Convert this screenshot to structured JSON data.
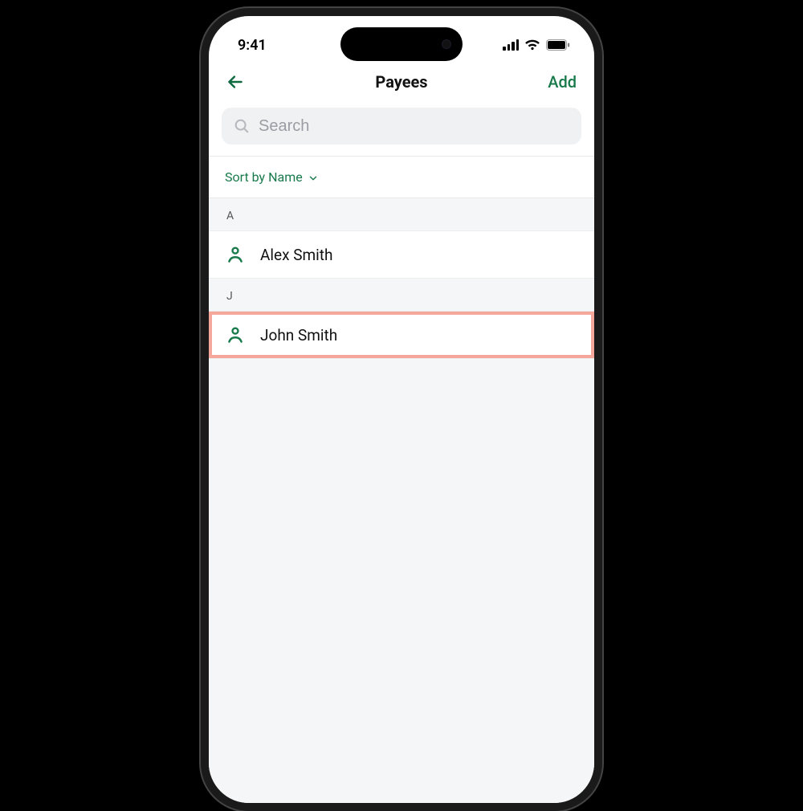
{
  "status": {
    "time": "9:41"
  },
  "nav": {
    "title": "Payees",
    "add_label": "Add"
  },
  "search": {
    "placeholder": "Search"
  },
  "sort": {
    "label": "Sort by Name"
  },
  "sections": [
    {
      "letter": "A",
      "items": [
        {
          "name": "Alex Smith",
          "highlighted": false
        }
      ]
    },
    {
      "letter": "J",
      "items": [
        {
          "name": "John Smith",
          "highlighted": true
        }
      ]
    }
  ],
  "colors": {
    "accent": "#187a4b",
    "highlight": "#f4a79a"
  }
}
